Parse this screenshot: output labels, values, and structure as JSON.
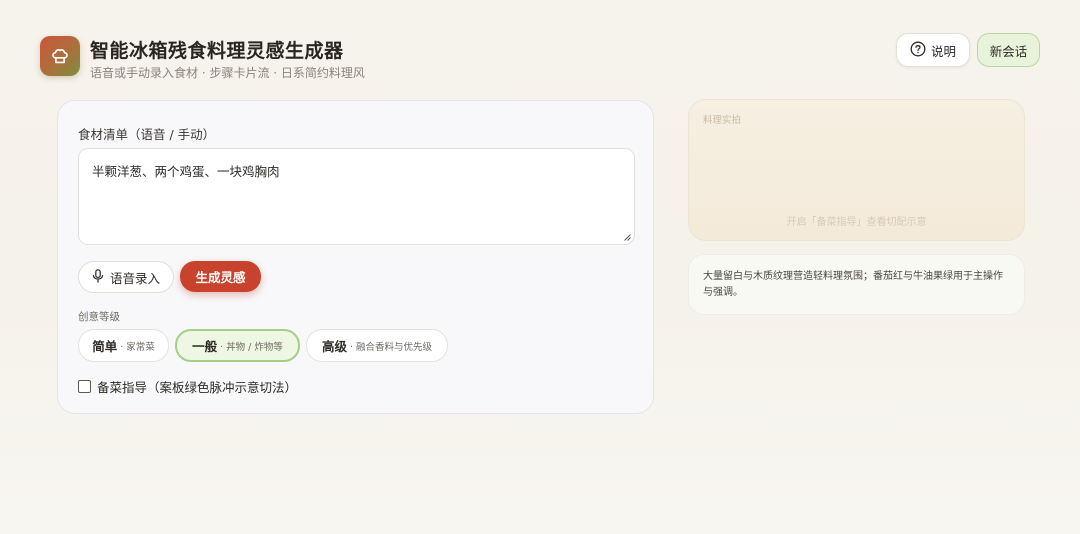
{
  "header": {
    "title": "智能冰箱残食料理灵感生成器",
    "subtitle": "语音或手动录入食材 · 步骤卡片流 · 日系简约料理风",
    "help_label": "说明",
    "new_session_label": "新会话"
  },
  "form": {
    "ingredients_label": "食材清单（语音 / 手动）",
    "ingredients_value": "半颗洋葱、两个鸡蛋、一块鸡胸肉",
    "voice_button": "语音录入",
    "generate_button": "生成灵感",
    "creativity_label": "创意等级",
    "levels": [
      {
        "name": "简单",
        "desc": "· 家常菜",
        "selected": false
      },
      {
        "name": "一般",
        "desc": "· 丼物 / 炸物等",
        "selected": true
      },
      {
        "name": "高级",
        "desc": "· 融合香料与优先级",
        "selected": false
      }
    ],
    "prep_guide_label": "备菜指导（案板绿色脉冲示意切法）",
    "prep_guide_checked": false
  },
  "preview": {
    "label": "料理实拍",
    "hint": "开启「备菜指导」查看切配示意"
  },
  "note": {
    "text": "大量留白与木质纹理营造轻料理氛围；番茄红与牛油果绿用于主操作与强调。"
  },
  "colors": {
    "primary": "#c8432e",
    "accent_green": "#a6cf86",
    "accent_green_bg": "#eef6e4"
  },
  "icons": {
    "logo": "chef-hat-icon",
    "help": "question-circle-icon",
    "voice": "microphone-icon"
  }
}
